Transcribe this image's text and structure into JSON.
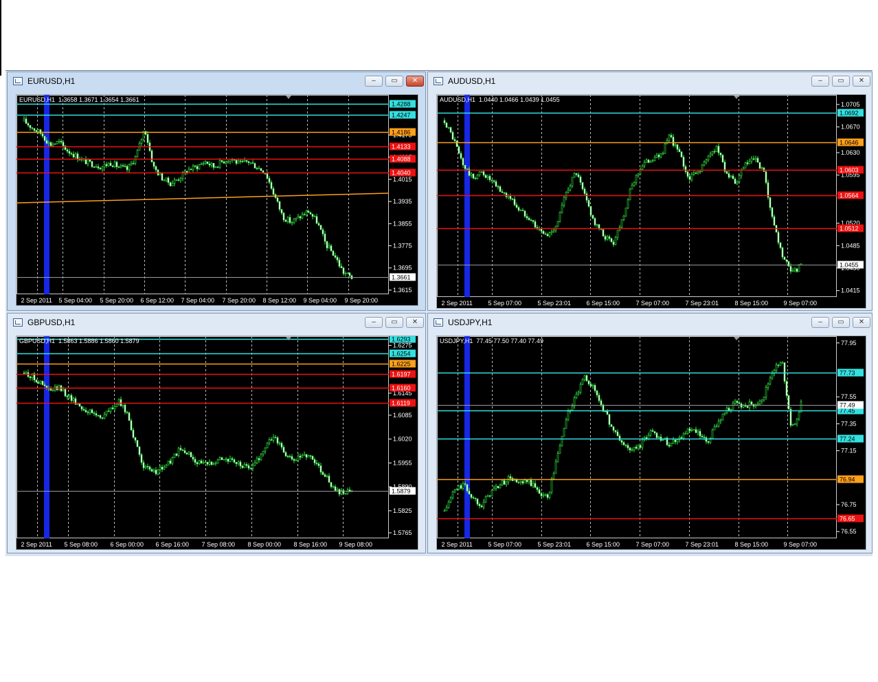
{
  "windows": [
    {
      "id": "eurusd",
      "title": "EURUSD,H1",
      "active": true,
      "ohlc": "EURUSD,H1  1.3658 1.3671 1.3654 1.3661",
      "chart_data": {
        "type": "candlestick",
        "symbol": "EURUSD",
        "timeframe": "H1",
        "ylim": [
          1.36,
          1.432
        ],
        "price_ticks": [
          "1.4175",
          "1.4095",
          "1.4015",
          "1.3935",
          "1.3855",
          "1.3775",
          "1.3695",
          "1.3615"
        ],
        "time_labels": [
          "2 Sep 2011",
          "5 Sep 04:00",
          "5 Sep 20:00",
          "6 Sep 12:00",
          "7 Sep 04:00",
          "7 Sep 20:00",
          "8 Sep 12:00",
          "9 Sep 04:00",
          "9 Sep 20:00"
        ],
        "current_price": "1.3661",
        "hlines": [
          {
            "price": "1.4288",
            "color": "#33e0e0"
          },
          {
            "price": "1.4247",
            "color": "#33e0e0"
          },
          {
            "price": "1.4186",
            "color": "#ff9f1a"
          },
          {
            "price": "1.4133",
            "color": "#ee1111"
          },
          {
            "price": "1.4088",
            "color": "#ee1111"
          },
          {
            "price": "1.4040",
            "color": "#ee1111"
          }
        ],
        "trendline": {
          "from_price": 1.393,
          "to_price": 1.3965,
          "color": "#ff9f1a"
        },
        "path": [
          1.4225,
          1.42,
          1.418,
          1.414,
          1.415,
          1.412,
          1.41,
          1.408,
          1.407,
          1.406,
          1.4075,
          1.406,
          1.405,
          1.41,
          1.42,
          1.406,
          1.402,
          1.4,
          1.402,
          1.405,
          1.406,
          1.408,
          1.406,
          1.408,
          1.409,
          1.407,
          1.408,
          1.406,
          1.404,
          1.396,
          1.388,
          1.386,
          1.388,
          1.39,
          1.386,
          1.378,
          1.374,
          1.368,
          1.366
        ]
      }
    },
    {
      "id": "audusd",
      "title": "AUDUSD,H1",
      "active": false,
      "ohlc": "AUDUSD,H1  1.0440 1.0466 1.0439 1.0455",
      "chart_data": {
        "type": "candlestick",
        "symbol": "AUDUSD",
        "timeframe": "H1",
        "ylim": [
          1.0405,
          1.072
        ],
        "price_ticks": [
          "1.0705",
          "1.0670",
          "1.0630",
          "1.0595",
          "1.0520",
          "1.0485",
          "1.0450",
          "1.0415"
        ],
        "time_labels": [
          "2 Sep 2011",
          "5 Sep 07:00",
          "5 Sep 23:01",
          "6 Sep 15:00",
          "7 Sep 07:00",
          "7 Sep 23:01",
          "8 Sep 15:00",
          "9 Sep 07:00"
        ],
        "current_price": "1.0455",
        "hlines": [
          {
            "price": "1.0692",
            "color": "#33e0e0"
          },
          {
            "price": "1.0646",
            "color": "#ff9f1a"
          },
          {
            "price": "1.0603",
            "color": "#ee1111"
          },
          {
            "price": "1.0564",
            "color": "#ee1111"
          },
          {
            "price": "1.0512",
            "color": "#ee1111"
          }
        ],
        "path": [
          1.068,
          1.065,
          1.061,
          1.059,
          1.06,
          1.0585,
          1.057,
          1.056,
          1.054,
          1.053,
          1.051,
          1.05,
          1.052,
          1.057,
          1.06,
          1.056,
          1.052,
          1.05,
          1.049,
          1.053,
          1.058,
          1.061,
          1.062,
          1.0625,
          1.0655,
          1.063,
          1.059,
          1.06,
          1.062,
          1.064,
          1.06,
          1.058,
          1.061,
          1.062,
          1.06,
          1.052,
          1.047,
          1.044,
          1.0455
        ]
      }
    },
    {
      "id": "gbpusd",
      "title": "GBPUSD,H1",
      "active": false,
      "ohlc": "GBPUSD,H1  1.5863 1.5886 1.5860 1.5879",
      "chart_data": {
        "type": "candlestick",
        "symbol": "GBPUSD",
        "timeframe": "H1",
        "ylim": [
          1.575,
          1.63
        ],
        "price_ticks": [
          "1.6275",
          "1.6145",
          "1.6085",
          "1.6020",
          "1.5955",
          "1.5890",
          "1.5825",
          "1.5765"
        ],
        "time_labels": [
          "2 Sep 2011",
          "5 Sep 08:00",
          "6 Sep 00:00",
          "6 Sep 16:00",
          "7 Sep 08:00",
          "8 Sep 00:00",
          "8 Sep 16:00",
          "9 Sep 08:00"
        ],
        "current_price": "1.5879",
        "hlines": [
          {
            "price": "1.6293",
            "color": "#33e0e0"
          },
          {
            "price": "1.6254",
            "color": "#33e0e0"
          },
          {
            "price": "1.6225",
            "color": "#ff9f1a"
          },
          {
            "price": "1.6197",
            "color": "#ee1111"
          },
          {
            "price": "1.6160",
            "color": "#ee1111"
          },
          {
            "price": "1.6119",
            "color": "#ee1111"
          }
        ],
        "path": [
          1.62,
          1.619,
          1.617,
          1.615,
          1.616,
          1.614,
          1.612,
          1.61,
          1.609,
          1.608,
          1.61,
          1.612,
          1.609,
          1.6,
          1.594,
          1.593,
          1.594,
          1.596,
          1.599,
          1.598,
          1.596,
          1.595,
          1.596,
          1.597,
          1.596,
          1.595,
          1.594,
          1.596,
          1.6,
          1.603,
          1.599,
          1.596,
          1.597,
          1.598,
          1.595,
          1.592,
          1.588,
          1.587,
          1.5879
        ]
      }
    },
    {
      "id": "usdjpy",
      "title": "USDJPY,H1",
      "active": false,
      "ohlc": "USDJPY,H1  77.45 77.50 77.40 77.49",
      "chart_data": {
        "type": "candlestick",
        "symbol": "USDJPY",
        "timeframe": "H1",
        "ylim": [
          76.5,
          78.0
        ],
        "price_ticks": [
          "77.95",
          "77.55",
          "77.35",
          "77.15",
          "76.75",
          "76.55"
        ],
        "time_labels": [
          "2 Sep 2011",
          "5 Sep 07:00",
          "5 Sep 23:01",
          "6 Sep 15:00",
          "7 Sep 07:00",
          "7 Sep 23:01",
          "8 Sep 15:00",
          "9 Sep 07:00"
        ],
        "current_price": "77.49",
        "hlines": [
          {
            "price": "77.73",
            "color": "#33e0e0"
          },
          {
            "price": "77.45",
            "color": "#33e0e0"
          },
          {
            "price": "77.24",
            "color": "#33e0e0"
          },
          {
            "price": "76.94",
            "color": "#ff9f1a"
          },
          {
            "price": "76.65",
            "color": "#ee1111"
          }
        ],
        "path": [
          76.7,
          76.85,
          76.9,
          76.8,
          76.75,
          76.85,
          76.9,
          76.95,
          76.9,
          76.92,
          76.85,
          76.8,
          77.1,
          77.4,
          77.55,
          77.7,
          77.6,
          77.45,
          77.3,
          77.2,
          77.15,
          77.2,
          77.3,
          77.25,
          77.2,
          77.25,
          77.3,
          77.28,
          77.2,
          77.35,
          77.45,
          77.5,
          77.48,
          77.5,
          77.55,
          77.75,
          77.8,
          77.3,
          77.49
        ]
      }
    }
  ]
}
